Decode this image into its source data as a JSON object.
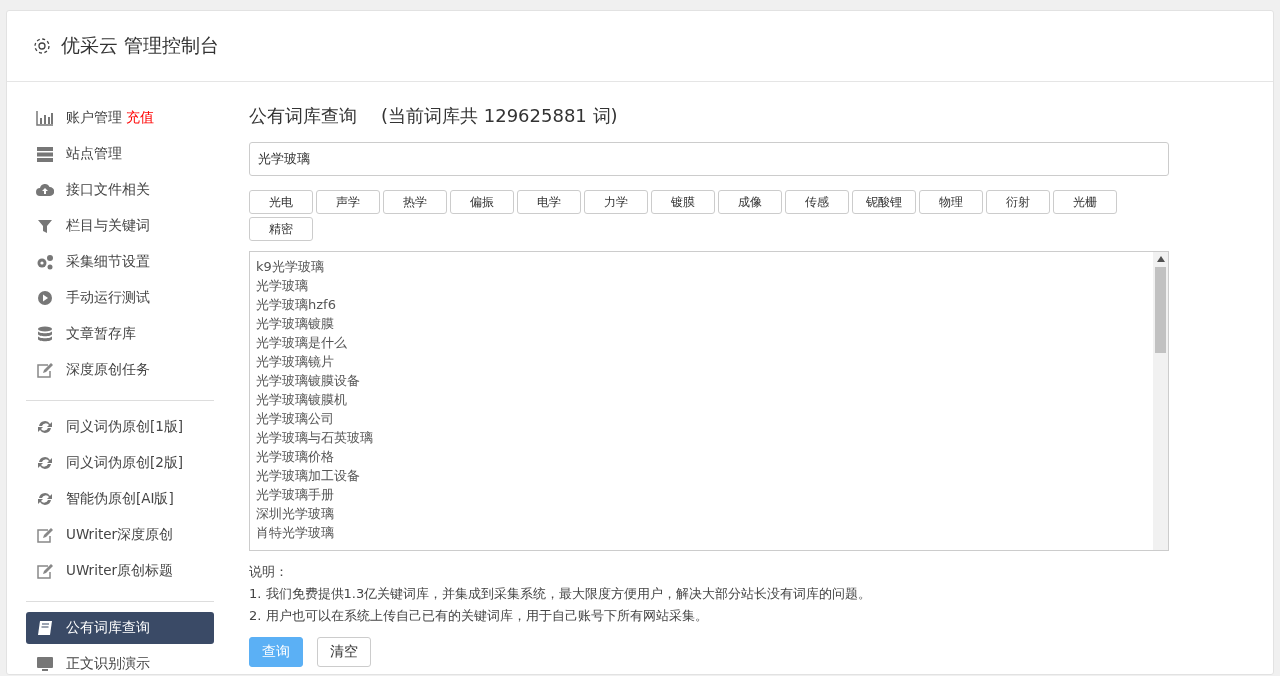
{
  "header": {
    "title": "优采云 管理控制台"
  },
  "sidebar": {
    "groups": [
      [
        {
          "kind": "bars",
          "label": "账户管理",
          "badge": "充值",
          "selected": false
        },
        {
          "kind": "server",
          "label": "站点管理",
          "selected": false
        },
        {
          "kind": "cloud",
          "label": "接口文件相关",
          "selected": false
        },
        {
          "kind": "filter",
          "label": "栏目与关键词",
          "selected": false
        },
        {
          "kind": "gears",
          "label": "采集细节设置",
          "selected": false
        },
        {
          "kind": "play",
          "label": "手动运行测试",
          "selected": false
        },
        {
          "kind": "database",
          "label": "文章暂存库",
          "selected": false
        },
        {
          "kind": "edit",
          "label": "深度原创任务",
          "selected": false
        }
      ],
      [
        {
          "kind": "refresh",
          "label": "同义词伪原创[1版]",
          "selected": false
        },
        {
          "kind": "refresh",
          "label": "同义词伪原创[2版]",
          "selected": false
        },
        {
          "kind": "refresh",
          "label": "智能伪原创[AI版]",
          "selected": false
        },
        {
          "kind": "edit",
          "label": "UWriter深度原创",
          "selected": false
        },
        {
          "kind": "edit",
          "label": "UWriter原创标题",
          "selected": false
        }
      ],
      [
        {
          "kind": "book",
          "label": "公有词库查询",
          "selected": true
        },
        {
          "kind": "monitor",
          "label": "正文识别演示",
          "selected": false
        }
      ]
    ]
  },
  "main": {
    "title": "公有词库查询",
    "subtitle": "(当前词库共 129625881 词)",
    "search": {
      "value": "光学玻璃"
    },
    "tags": [
      "光电",
      "声学",
      "热学",
      "偏振",
      "电学",
      "力学",
      "镀膜",
      "成像",
      "传感",
      "铌酸锂",
      "物理",
      "衍射",
      "光栅",
      "精密"
    ],
    "results": [
      "k9光学玻璃",
      "光学玻璃",
      "光学玻璃hzf6",
      "光学玻璃镀膜",
      "光学玻璃是什么",
      "光学玻璃镜片",
      "光学玻璃镀膜设备",
      "光学玻璃镀膜机",
      "光学玻璃公司",
      "光学玻璃与石英玻璃",
      "光学玻璃价格",
      "光学玻璃加工设备",
      "光学玻璃手册",
      "深圳光学玻璃",
      "肖特光学玻璃"
    ],
    "notes_title": "说明：",
    "notes": [
      "1. 我们免费提供1.3亿关键词库，并集成到采集系统，最大限度方便用户，解决大部分站长没有词库的问题。",
      "2. 用户也可以在系统上传自己已有的关键词库，用于自己账号下所有网站采集。"
    ],
    "buttons": [
      {
        "label": "查询",
        "kind": "primary"
      },
      {
        "label": "清空",
        "kind": "default"
      }
    ]
  }
}
